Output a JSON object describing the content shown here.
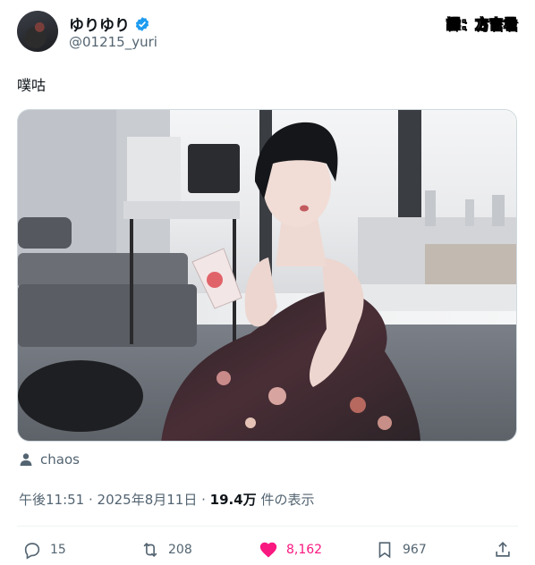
{
  "user": {
    "display_name": "ゆりゆり",
    "handle": "@01215_yuri",
    "verified_icon": "verified-badge-icon"
  },
  "translator_tag": "譯：方吉君",
  "tweet": {
    "text": "噗咕",
    "media_alt": "photo"
  },
  "location": {
    "icon": "person-icon",
    "label": "chaos"
  },
  "meta": {
    "time": "午後11:51",
    "sep1": " · ",
    "date": "2025年8月11日",
    "sep2": " · ",
    "views_count": "19.4万",
    "views_label": " 件の表示"
  },
  "actions": {
    "replies": "15",
    "retweets": "208",
    "likes": "8,162",
    "bookmarks": "967"
  },
  "colors": {
    "accent_like": "#f91880",
    "verified": "#1d9bf0",
    "secondary_text": "#536471"
  }
}
